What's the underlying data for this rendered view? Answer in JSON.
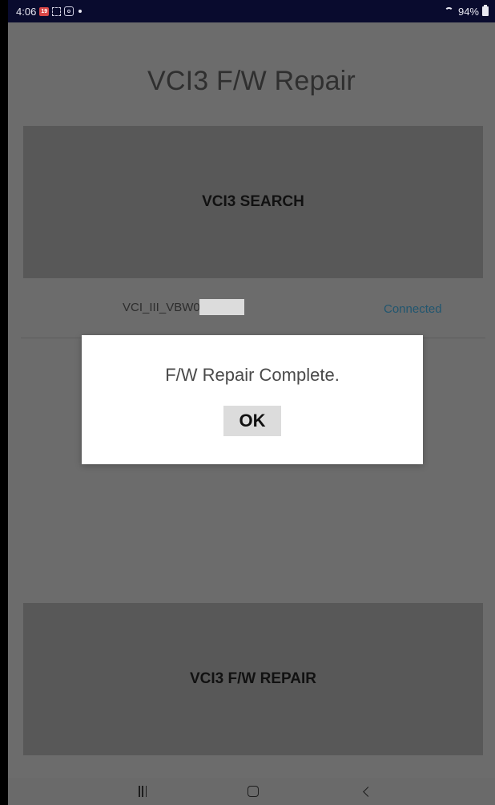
{
  "status_bar": {
    "time": "4:06",
    "calendar_badge": "19",
    "battery_text": "94%"
  },
  "icons": {
    "calendar": "calendar-icon",
    "dotted_frame": "dotted-frame-icon",
    "scan": "scan-icon",
    "notification_dot": "notification-dot-icon",
    "wifi": "wifi-icon",
    "battery": "battery-icon",
    "recents": "recents-icon",
    "home": "home-icon",
    "back": "back-icon"
  },
  "app": {
    "title": "VCI3 F/W Repair"
  },
  "buttons": {
    "search_label": "VCI3 SEARCH",
    "repair_label": "VCI3 F/W REPAIR"
  },
  "device": {
    "name_prefix": "VCI_III_VBW0",
    "status": "Connected"
  },
  "dialog": {
    "message": "F/W Repair Complete.",
    "ok_label": "OK"
  },
  "colors": {
    "status_bar_bg": "#090b2e",
    "screen_bg": "#6c6c6c",
    "button_bg": "#585858",
    "connected_text": "#21566f",
    "dialog_bg": "#ffffff"
  }
}
